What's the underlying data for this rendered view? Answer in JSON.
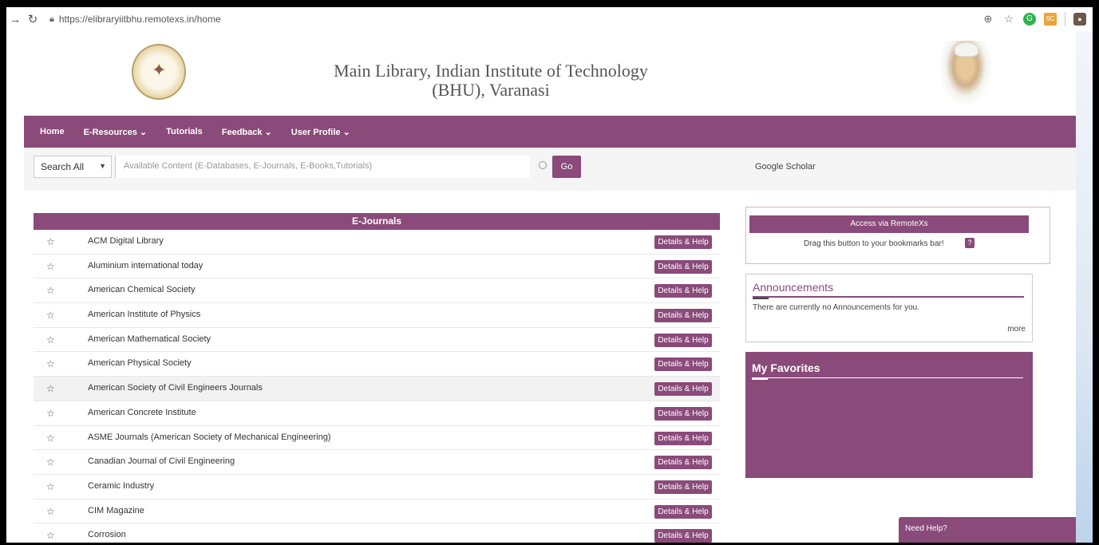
{
  "browser": {
    "url": "https://elibraryiitbhu.remotexs.in/home",
    "icons": [
      "back-arrow-icon",
      "reload-icon",
      "lock-icon",
      "zoom-icon",
      "star-icon",
      "grammarly-icon",
      "sc-extension-icon",
      "profile-avatar-icon"
    ]
  },
  "header": {
    "title_line1": "Main Library, Indian Institute of Technology",
    "title_line2": "(BHU), Varanasi"
  },
  "nav": {
    "home": "Home",
    "eresources": "E-Resources ⌄",
    "tutorials": "Tutorials",
    "feedback": "Feedback ⌄",
    "profile": "User Profile ⌄"
  },
  "search": {
    "scope": "Search All",
    "placeholder": "Available Content (E-Databases, E-Journals, E-Books,Tutorials)",
    "go": "Go",
    "scholar": "Google Scholar"
  },
  "journals": {
    "heading": "E-Journals",
    "button_label": "Details & Help",
    "items": [
      "ACM Digital Library",
      "Aluminium international today",
      "American Chemical Society",
      "American Institute of Physics",
      "American Mathematical Society",
      "American Physical Society",
      "American Society of Civil Engineers Journals",
      "American Concrete Institute",
      "ASME Journals (American Society of Mechanical Engineering)",
      "Canadian Journal of Civil Engineering",
      "Ceramic Industry",
      "CIM Magazine",
      "Corrosion"
    ]
  },
  "remotex": {
    "button": "Access via RemoteXs",
    "drag_text": "Drag this button to your bookmarks bar!",
    "help": "?"
  },
  "announcements": {
    "title": "Announcements",
    "text": "There are currently no Announcements for you.",
    "more": "more"
  },
  "favorites": {
    "title": "My Favorites"
  },
  "help": {
    "label": "Need Help?"
  },
  "colors": {
    "brand": "#8a4a7a"
  }
}
